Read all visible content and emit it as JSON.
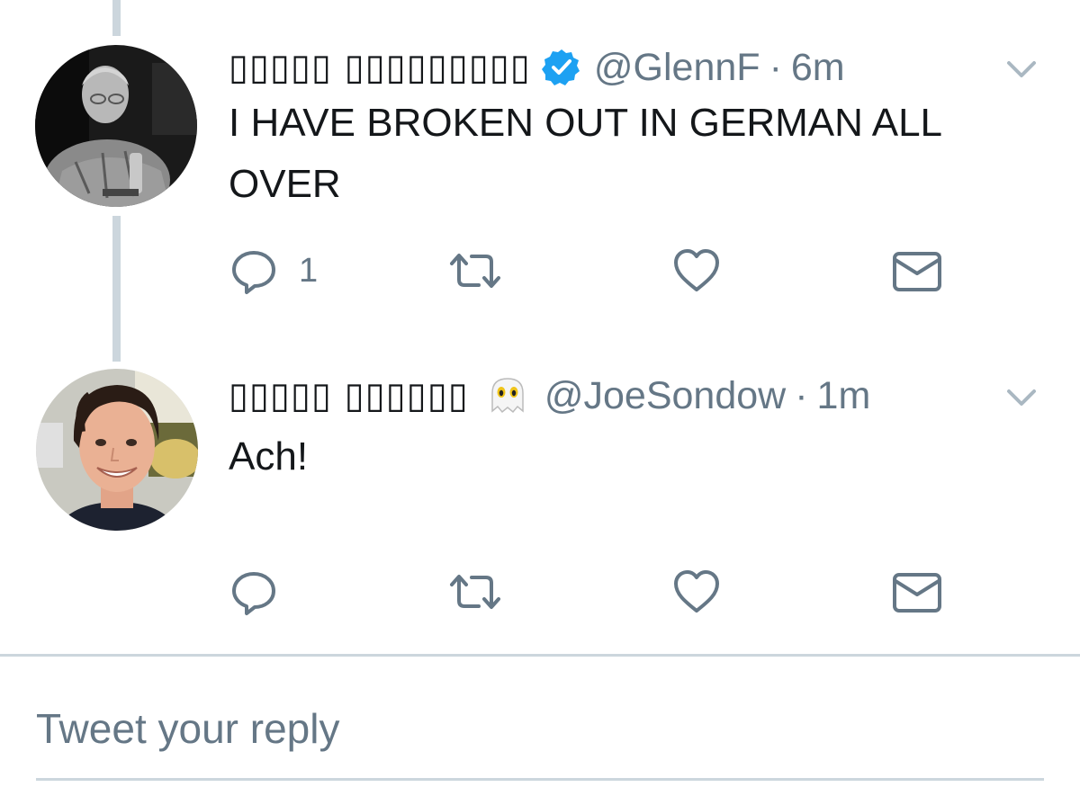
{
  "tweets": [
    {
      "display_name": "▯▯▯▯▯ ▯▯▯▯▯▯▯▯▯",
      "badge_icon": "verified-badge-icon",
      "handle": "@GlennF",
      "separator": "·",
      "time": "6m",
      "text": "I HAVE BROKEN OUT IN GERMAN ALL OVER",
      "reply_count": "1"
    },
    {
      "display_name": "▯▯▯▯▯ ▯▯▯▯▯▯",
      "badge_icon": "ghost-emoji-icon",
      "handle": "@JoeSondow",
      "separator": "·",
      "time": "1m",
      "text": "Ach!",
      "reply_count": ""
    }
  ],
  "reply": {
    "placeholder": "Tweet your reply"
  },
  "colors": {
    "text": "#14171a",
    "secondary": "#657786",
    "verified": "#1da1f2",
    "divider": "#ccd6dd"
  }
}
